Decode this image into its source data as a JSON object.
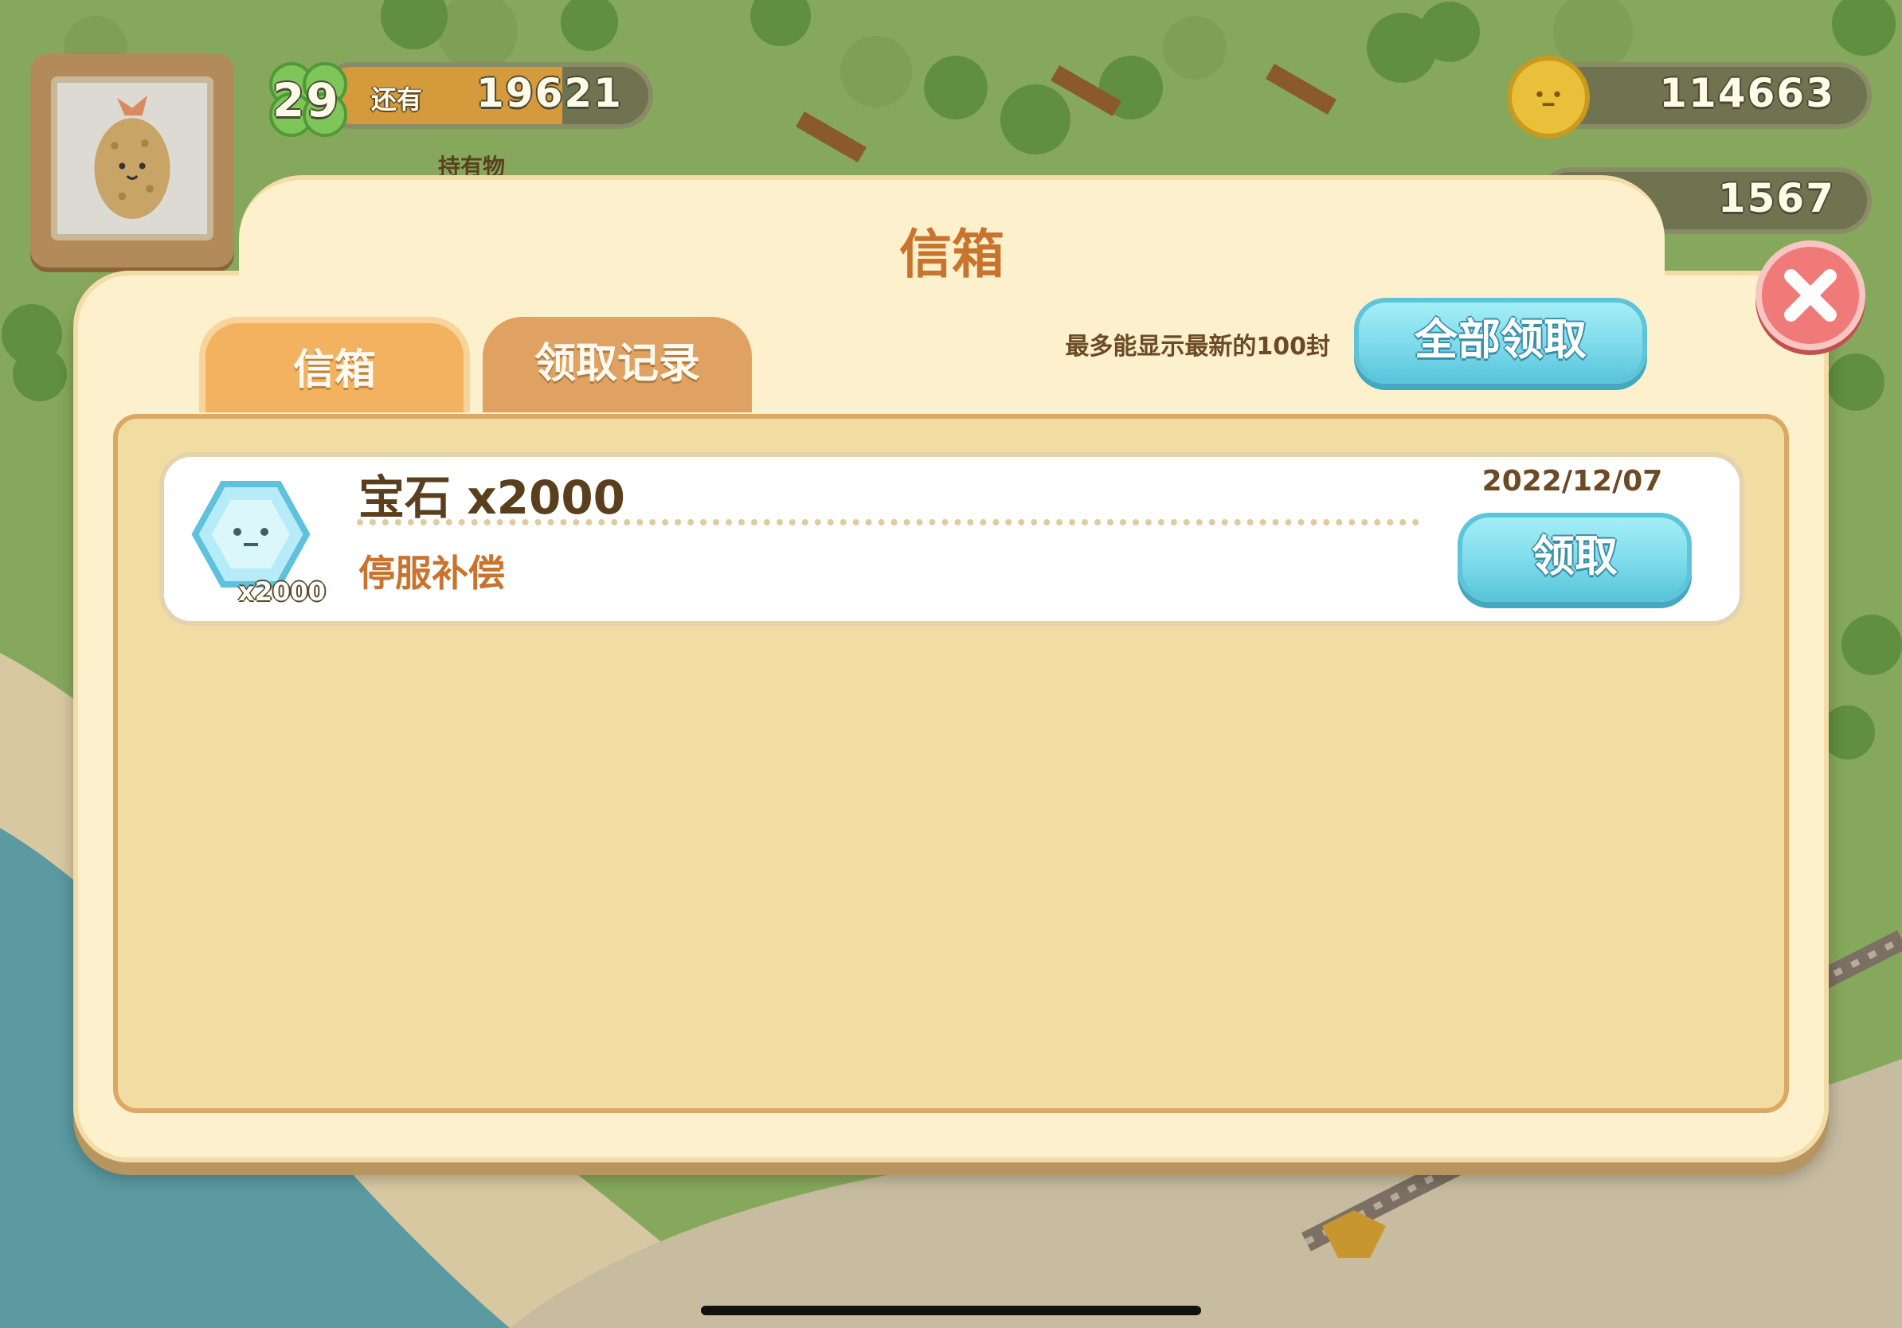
{
  "hud": {
    "level": "29",
    "exp_label": "还有",
    "exp_value": "19621",
    "inventory_label": "持有物",
    "coins": "114663",
    "gems": "1567"
  },
  "dialog": {
    "title": "信箱",
    "tabs": [
      {
        "label": "信箱",
        "active": true
      },
      {
        "label": "领取记录",
        "active": false
      }
    ],
    "hint": "最多能显示最新的100封",
    "claim_all_label": "全部领取"
  },
  "mails": [
    {
      "item_icon": "gem-icon",
      "item_qty": "x2000",
      "title": "宝石 x2000",
      "subtitle": "停服补偿",
      "date": "2022/12/07",
      "claim_label": "领取"
    }
  ],
  "colors": {
    "title": "#c8742e",
    "tab_active": "#f3b25f",
    "tab_inactive": "#dfa262",
    "button_blue": "#7ad9ea",
    "close_red": "#f07a78",
    "panel": "#fdf0cd"
  }
}
